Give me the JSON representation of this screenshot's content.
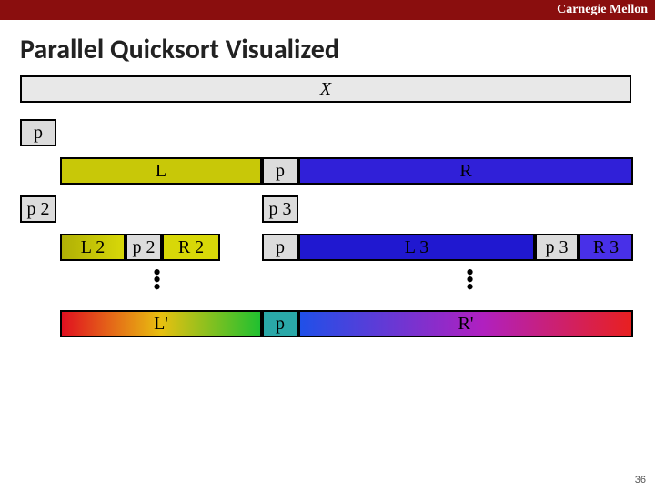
{
  "branding": {
    "org": "Carnegie Mellon"
  },
  "title": "Parallel Quicksort Visualized",
  "row1": {
    "X": "X"
  },
  "row2": {
    "p": "p"
  },
  "row3": {
    "L": "L",
    "p": "p",
    "R": "R"
  },
  "row4": {
    "p2": "p 2",
    "p3": "p 3"
  },
  "row5": {
    "L2": "L 2",
    "p2": "p 2",
    "R2": "R 2",
    "p": "p",
    "L3": "L 3",
    "p3": "p 3",
    "R3": "R 3"
  },
  "row7": {
    "Lprime": "L'",
    "p": "p",
    "Rprime": "R'"
  },
  "page_num": "36",
  "colors": {
    "topbar": "#8a0e0e",
    "grey_fill": "#e8e8e8",
    "pivot_fill": "#dcdcdc",
    "L_fill": "#c8c808",
    "R_fill": "#3020d8",
    "teal": "#2aa8a8"
  }
}
